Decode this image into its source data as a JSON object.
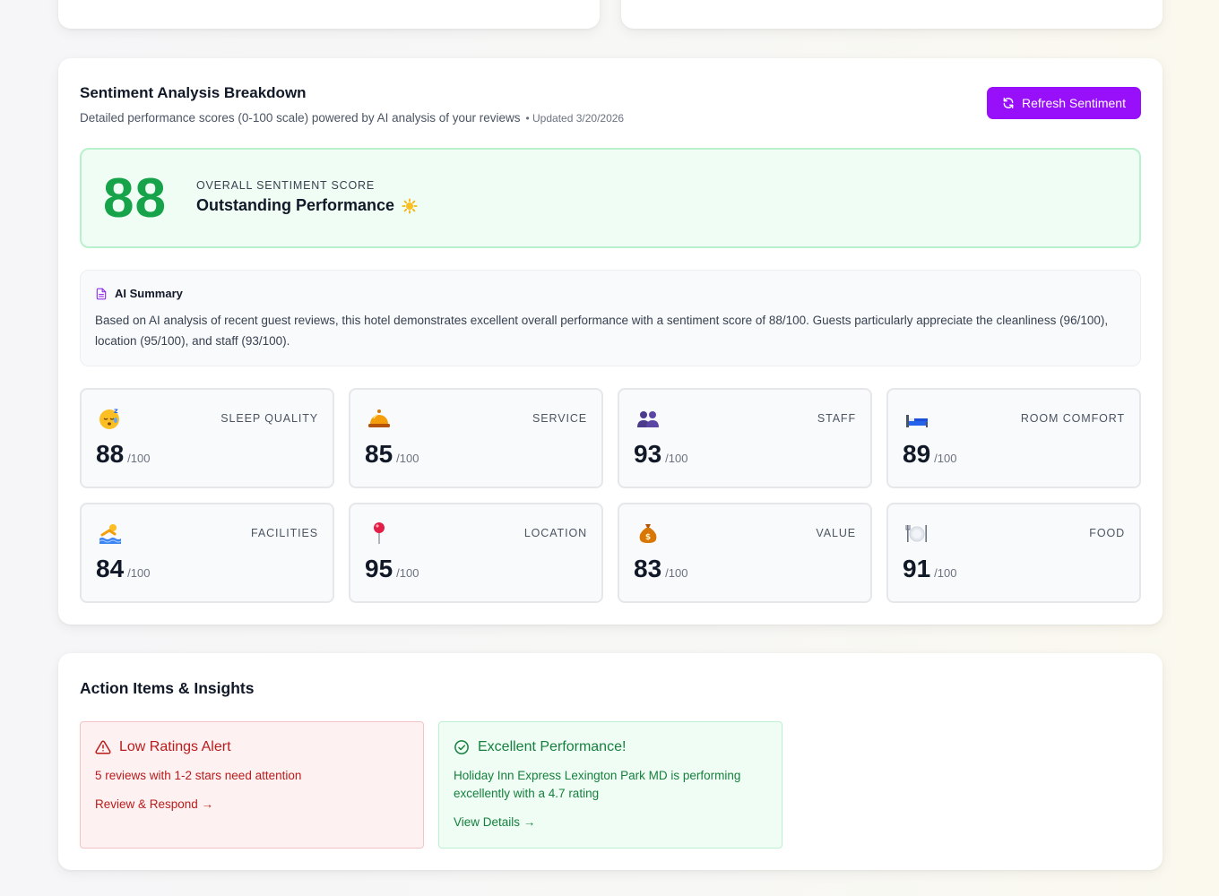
{
  "sentiment": {
    "title": "Sentiment Analysis Breakdown",
    "subtitle": "Detailed performance scores (0-100 scale) powered by AI analysis of your reviews",
    "updated": "• Updated 3/20/2026",
    "refresh_label": "Refresh Sentiment",
    "accent_color": "#9810fa",
    "overall": {
      "score": "88",
      "label": "OVERALL SENTIMENT SCORE",
      "rating": "Outstanding Performance",
      "color": "#16a34a"
    },
    "summary": {
      "heading": "AI Summary",
      "text": "Based on AI analysis of recent guest reviews, this hotel demonstrates excellent overall performance with a sentiment score of 88/100. Guests particularly appreciate the cleanliness (96/100), location (95/100), and staff (93/100)."
    },
    "metrics": [
      {
        "name": "SLEEP QUALITY",
        "value": "88",
        "max": "/100",
        "icon": "sleeping-face-icon"
      },
      {
        "name": "SERVICE",
        "value": "85",
        "max": "/100",
        "icon": "bellhop-bell-icon"
      },
      {
        "name": "STAFF",
        "value": "93",
        "max": "/100",
        "icon": "people-icon"
      },
      {
        "name": "ROOM COMFORT",
        "value": "89",
        "max": "/100",
        "icon": "bed-icon"
      },
      {
        "name": "FACILITIES",
        "value": "84",
        "max": "/100",
        "icon": "swimmer-icon"
      },
      {
        "name": "LOCATION",
        "value": "95",
        "max": "/100",
        "icon": "pushpin-icon"
      },
      {
        "name": "VALUE",
        "value": "83",
        "max": "/100",
        "icon": "money-bag-icon"
      },
      {
        "name": "FOOD",
        "value": "91",
        "max": "/100",
        "icon": "plate-cutlery-icon"
      }
    ]
  },
  "actions": {
    "title": "Action Items & Insights",
    "low": {
      "heading": "Low Ratings Alert",
      "message": "5 reviews with 1-2 stars need attention",
      "link": "Review & Respond →"
    },
    "excellent": {
      "heading": "Excellent Performance!",
      "message": "Holiday Inn Express Lexington Park MD is performing excellently with a 4.7 rating",
      "link": "View Details →"
    }
  }
}
